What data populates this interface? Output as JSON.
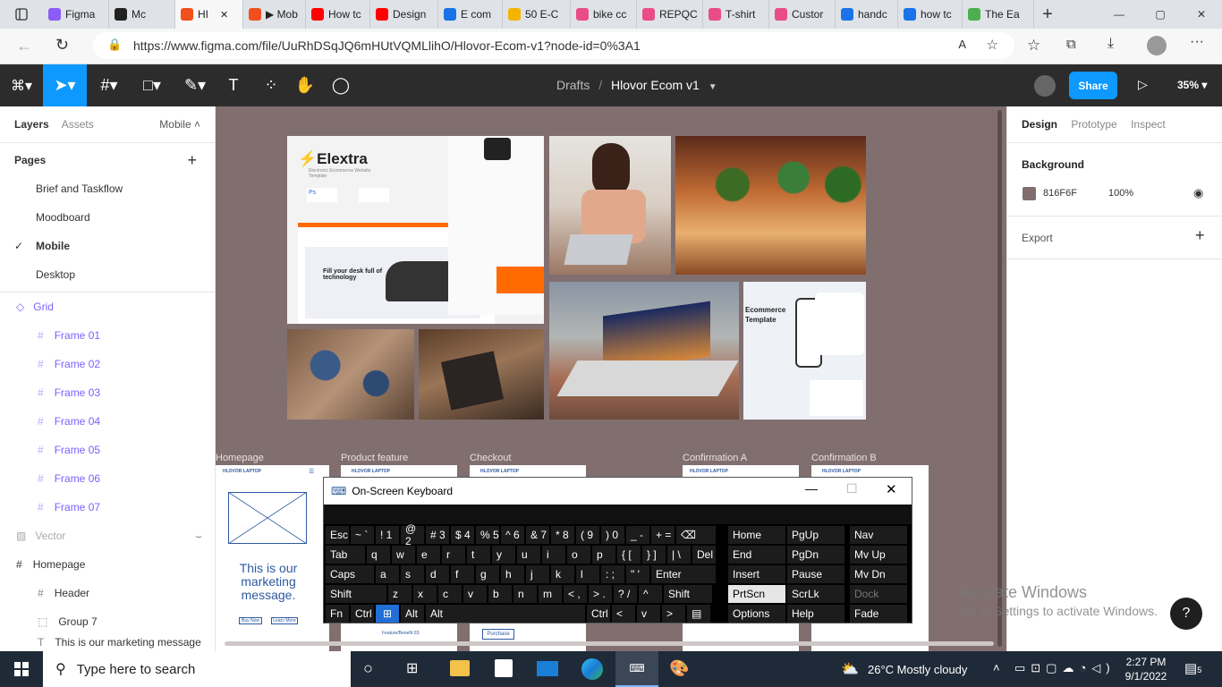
{
  "browser": {
    "tabs": [
      {
        "label": "Figma",
        "color": "#8b5cf6"
      },
      {
        "label": "Mc",
        "color": "#222222"
      },
      {
        "label": "HI",
        "color": "#f24e1e"
      },
      {
        "label": "▶ Mob",
        "color": "#f24e1e"
      },
      {
        "label": "How tc",
        "color": "#ff0000"
      },
      {
        "label": "Design",
        "color": "#ff0000"
      },
      {
        "label": "E com",
        "color": "#1a73e8"
      },
      {
        "label": "50 E-C",
        "color": "#f4b400"
      },
      {
        "label": "bike cc",
        "color": "#ea4c89"
      },
      {
        "label": "REPQC",
        "color": "#ea4c89"
      },
      {
        "label": "T-shirt",
        "color": "#ea4c89"
      },
      {
        "label": "Custor",
        "color": "#ea4c89"
      },
      {
        "label": "handc",
        "color": "#1a73e8"
      },
      {
        "label": "how tc",
        "color": "#1a73e8"
      },
      {
        "label": "The Ea",
        "color": "#4caf50"
      }
    ],
    "url": "https://www.figma.com/file/UuRhDSqJQ6mHUtVQMLlihO/Hlovor-Ecom-v1?node-id=0%3A1"
  },
  "figma": {
    "breadcrumb_root": "Drafts",
    "breadcrumb_sep": "/",
    "file_name": "Hlovor Ecom v1",
    "share_label": "Share",
    "zoom": "35%"
  },
  "left_panel": {
    "tab_layers": "Layers",
    "tab_assets": "Assets",
    "page_selector": "Mobile",
    "pages_heading": "Pages",
    "pages": [
      "Brief and Taskflow",
      "Moodboard",
      "Mobile",
      "Desktop"
    ],
    "grid_label": "Grid",
    "frames": [
      "Frame 01",
      "Frame 02",
      "Frame 03",
      "Frame 04",
      "Frame 05",
      "Frame 06",
      "Frame 07"
    ],
    "vector_label": "Vector",
    "homepage_label": "Homepage",
    "header_label": "Header",
    "group_label": "Group 7",
    "marketing_label": "This is our marketing message"
  },
  "right_panel": {
    "tab_design": "Design",
    "tab_prototype": "Prototype",
    "tab_inspect": "Inspect",
    "background_heading": "Background",
    "bg_hex": "816F6F",
    "bg_opacity": "100%",
    "export_label": "Export"
  },
  "canvas": {
    "elextra_title": "Elextra",
    "elextra_sub": "Electronic Ecommerce Website Template",
    "elextra_hero": "Fill your desk full of technology",
    "ecom_template": "Ecommerce Template",
    "frame_labels": [
      "Homepage",
      "Product feature",
      "Checkout",
      "Confirmation A",
      "Confirmation B"
    ],
    "wire_logo": "HLOVOR LAPTOP",
    "marketing_message": "This is our marketing message.",
    "buy_now": "Buy Now",
    "learn_more": "Learn More",
    "purchase": "Purchase",
    "feature_benefit": "Feature/Benefit 03:"
  },
  "osk": {
    "title": "On-Screen Keyboard",
    "rows": [
      [
        "Esc",
        "~ `",
        "! 1",
        "@ 2",
        "# 3",
        "$ 4",
        "% 5",
        "^ 6",
        "& 7",
        "* 8",
        "( 9",
        ") 0",
        "_ -",
        "+ =",
        "⌫"
      ],
      [
        "Tab",
        "q",
        "w",
        "e",
        "r",
        "t",
        "y",
        "u",
        "i",
        "o",
        "p",
        "{ [",
        "} ]",
        "| \\",
        "Del"
      ],
      [
        "Caps",
        "a",
        "s",
        "d",
        "f",
        "g",
        "h",
        "j",
        "k",
        "l",
        ": ;",
        "\" '",
        "Enter"
      ],
      [
        "Shift",
        "z",
        "x",
        "c",
        "v",
        "b",
        "n",
        "m",
        "< ,",
        "> .",
        "? /",
        "^",
        "Shift"
      ],
      [
        "Fn",
        "Ctrl",
        "⊞",
        "Alt",
        "Alt",
        "Ctrl",
        "<",
        "v",
        ">",
        "▤"
      ]
    ],
    "nav_keys": [
      [
        "Home",
        "PgUp",
        "Nav"
      ],
      [
        "End",
        "PgDn",
        "Mv Up"
      ],
      [
        "Insert",
        "Pause",
        "Mv Dn"
      ],
      [
        "PrtScn",
        "ScrLk",
        "Dock"
      ],
      [
        "Options",
        "Help",
        "Fade"
      ]
    ]
  },
  "watermark": {
    "line1": "Activate Windows",
    "line2": "Go to Settings to activate Windows."
  },
  "taskbar": {
    "search_placeholder": "Type here to search",
    "weather": "26°C  Mostly cloudy",
    "time": "2:27 PM",
    "date": "9/1/2022",
    "notification_count": "5"
  }
}
